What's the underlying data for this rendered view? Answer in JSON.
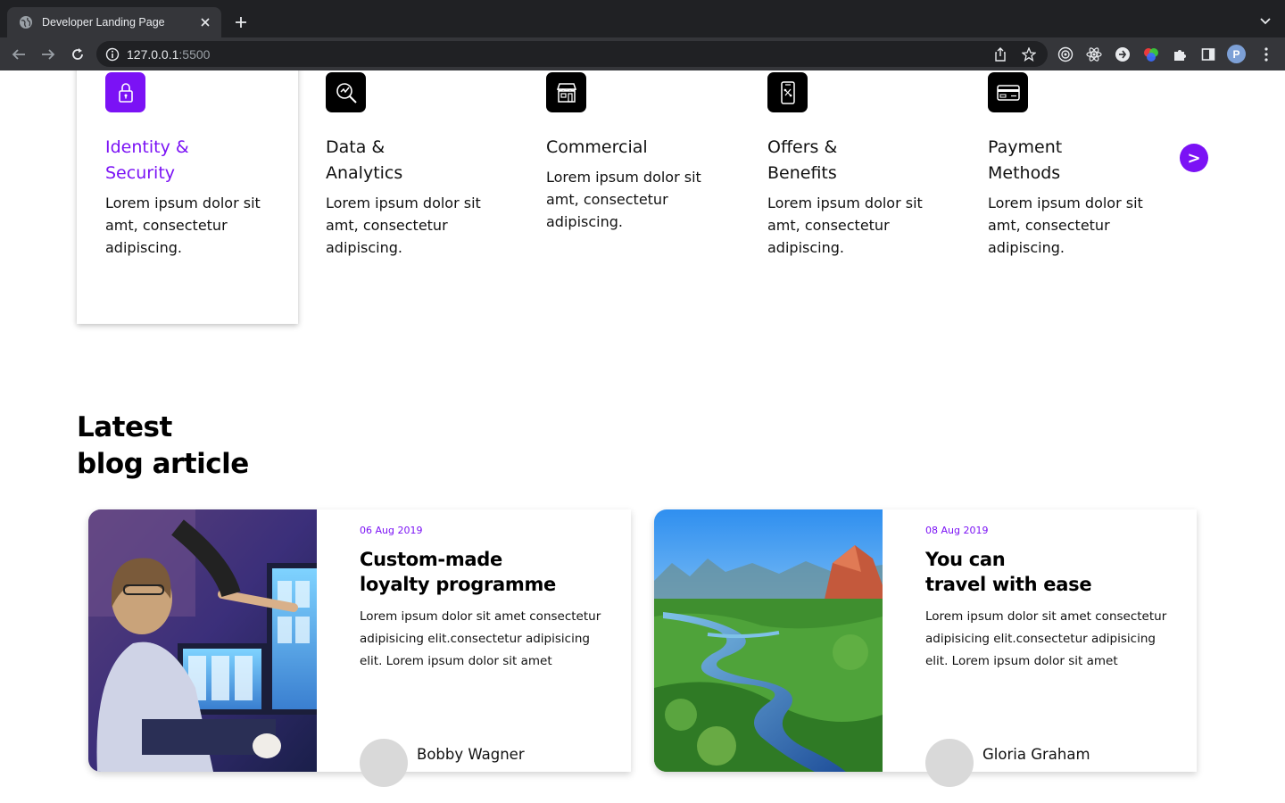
{
  "browser": {
    "tab_title": "Developer Landing Page",
    "url_host": "127.0.0.1",
    "url_port": ":5500",
    "profile_initial": "P"
  },
  "features": {
    "items": [
      {
        "title": "Identity & Security",
        "desc": "Lorem ipsum dolor sit amt, consectetur adipiscing.",
        "icon": "lock-icon",
        "active": true
      },
      {
        "title": "Data & Analytics",
        "desc": "Lorem ipsum dolor sit amt, consectetur adipiscing.",
        "icon": "magnifier-chart-icon",
        "active": false
      },
      {
        "title": "Commercial",
        "desc": "Lorem ipsum dolor sit amt, consectetur adipiscing.",
        "icon": "storefront-icon",
        "active": false
      },
      {
        "title": "Offers & Benefits",
        "desc": "Lorem ipsum dolor sit amt, consectetur adipiscing.",
        "icon": "phone-offer-icon",
        "active": false
      },
      {
        "title": "Payment Methods",
        "desc": "Lorem ipsum dolor sit amt, consectetur adipiscing.",
        "icon": "credit-card-icon",
        "active": false
      }
    ],
    "next_label": ">"
  },
  "blog": {
    "heading_line1": "Latest",
    "heading_line2": "blog article",
    "articles": [
      {
        "date": "06 Aug 2019",
        "title_line1": "Custom-made",
        "title_line2": "loyalty programme",
        "excerpt": "Lorem ipsum dolor sit amet consectetur adipisicing elit.consectetur adipisicing elit. Lorem ipsum dolor sit amet",
        "author": "Bobby Wagner",
        "image": "developer-at-monitors-photo"
      },
      {
        "date": "08 Aug 2019",
        "title_line1": "You can",
        "title_line2": "travel with ease",
        "excerpt": "Lorem ipsum dolor sit amet consectetur adipisicing elit.consectetur adipisicing elit. Lorem ipsum dolor sit amet",
        "author": "Gloria Graham",
        "image": "river-landscape-photo"
      }
    ]
  },
  "colors": {
    "accent": "#7b12f5",
    "chrome_dark": "#202124",
    "chrome_tab": "#35363a"
  }
}
